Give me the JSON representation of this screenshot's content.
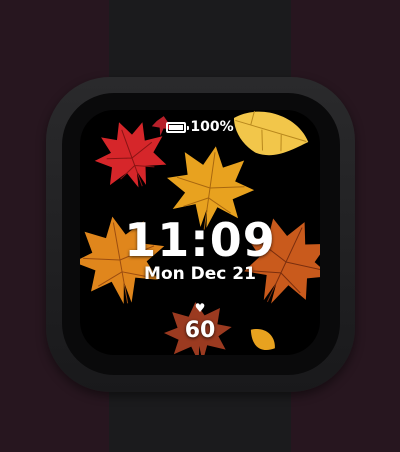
{
  "device": {
    "type": "smartwatch",
    "band_color": "#1b1b1d",
    "case_color": "#2a2a2c",
    "background_color": "#27161f"
  },
  "watch_face": {
    "theme": "autumn-leaves",
    "status": {
      "battery_icon": "battery-icon",
      "battery_level": 1.0,
      "battery_text": "100%"
    },
    "time": "11:09",
    "date": "Mon Dec 21",
    "heart_icon": "heart-icon",
    "heart_rate": "60",
    "leaf_colors": [
      "#d6262a",
      "#e8a21f",
      "#f2c64a",
      "#c95a1c",
      "#9b3a20"
    ]
  }
}
